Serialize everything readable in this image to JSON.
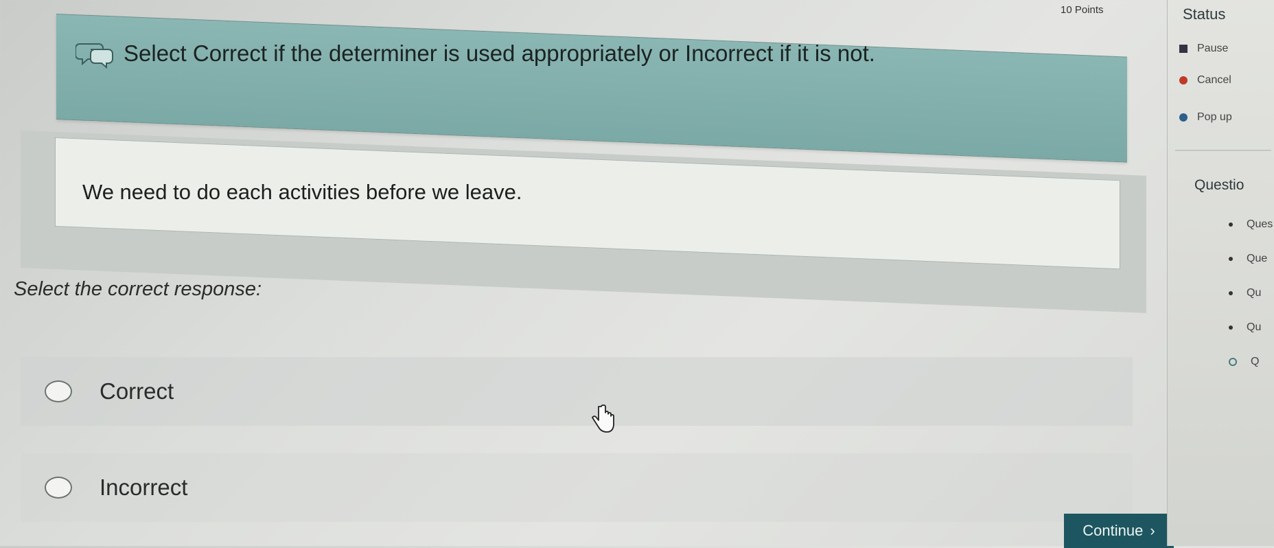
{
  "header": {
    "points": "10 Points"
  },
  "instruction": {
    "text": "Select Correct if the determiner is used appropriately or Incorrect if it is not."
  },
  "question": {
    "text": "We need to do each activities before we leave."
  },
  "prompt": "Select the correct response:",
  "options": [
    {
      "label": "Correct"
    },
    {
      "label": "Incorrect"
    }
  ],
  "continue_button": {
    "label": "Continue"
  },
  "status_panel": {
    "title": "Status",
    "items": [
      {
        "label": "Pause",
        "icon": "pause-icon"
      },
      {
        "label": "Cancel",
        "icon": "cancel-icon"
      },
      {
        "label": "Pop up",
        "icon": "popup-icon"
      }
    ]
  },
  "questions_panel": {
    "title": "Questio",
    "items": [
      {
        "label": "Ques"
      },
      {
        "label": "Que"
      },
      {
        "label": "Qu"
      },
      {
        "label": "Qu"
      },
      {
        "label": "Q"
      }
    ]
  },
  "colors": {
    "instruction_band": "#7ba9a6",
    "continue_button": "#1d5660"
  }
}
